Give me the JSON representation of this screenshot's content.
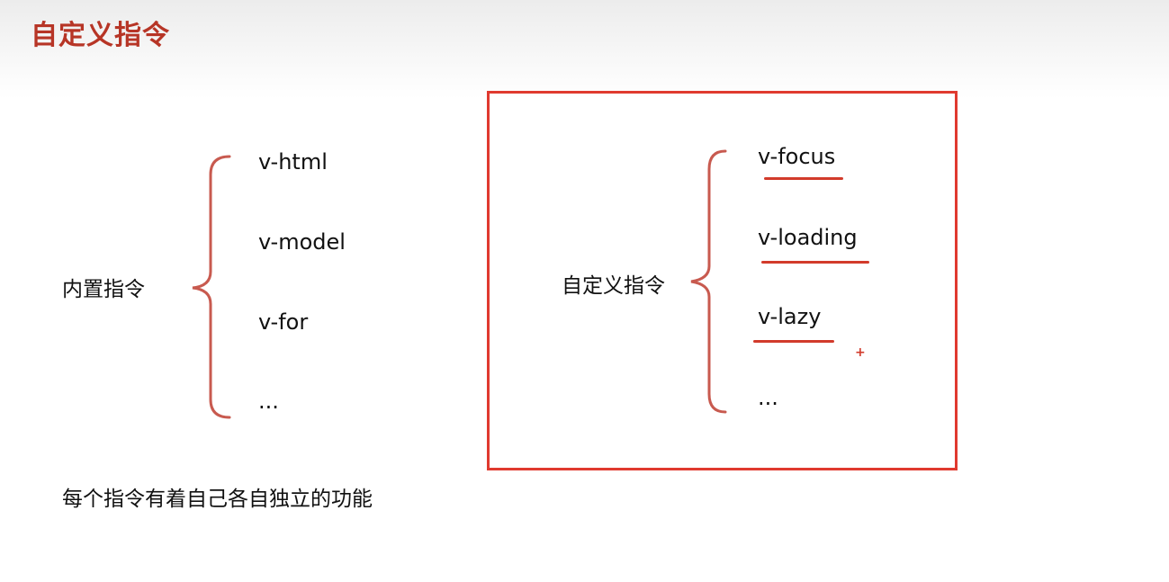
{
  "slide": {
    "title": "自定义指令",
    "footer_text": "每个指令有着自己各自独立的功能"
  },
  "builtin": {
    "label": "内置指令",
    "items": [
      "v-html",
      "v-model",
      "v-for",
      "..."
    ]
  },
  "custom": {
    "label": "自定义指令",
    "items": [
      "v-focus",
      "v-loading",
      "v-lazy",
      "..."
    ]
  },
  "annotations": {
    "plus_mark": "+"
  },
  "colors": {
    "title": "#b73526",
    "box_border": "#e03a2f",
    "brace": "#c85a4f",
    "underline": "#d23b2b"
  }
}
